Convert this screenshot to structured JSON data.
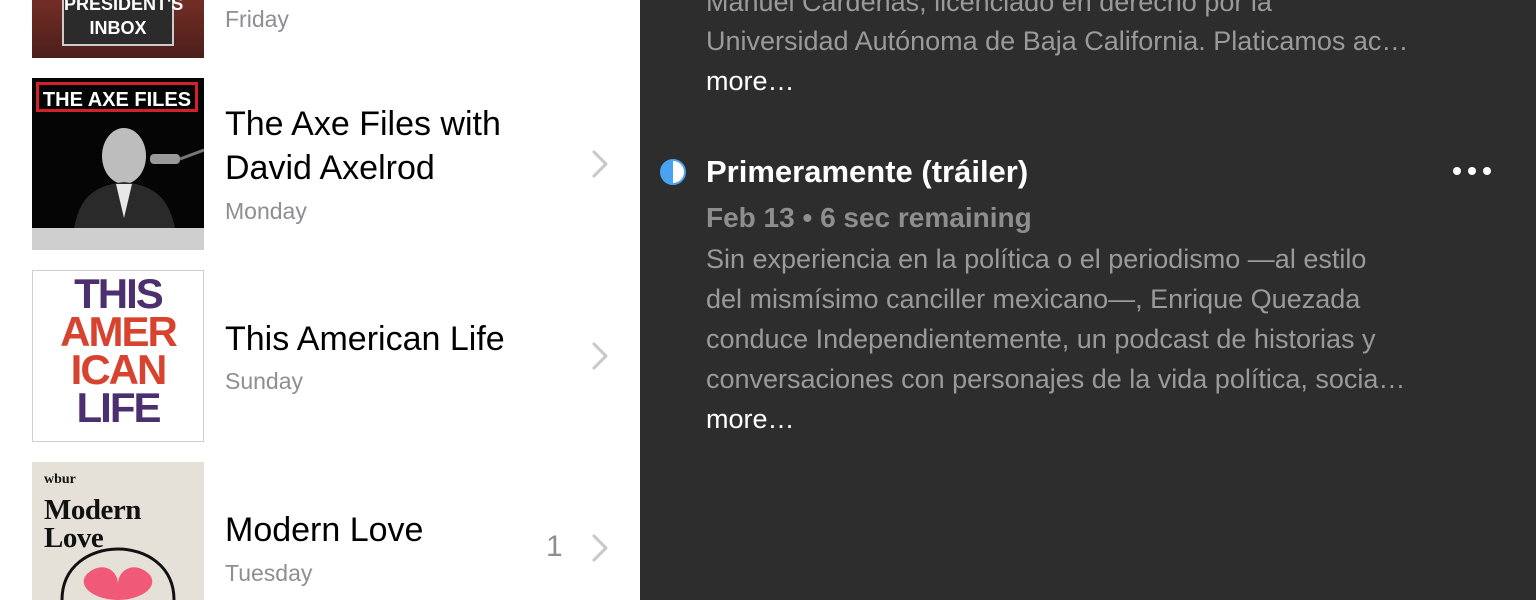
{
  "list": {
    "items": [
      {
        "art_text": "PRESIDENT'S INBOX",
        "subtitle": "Friday"
      },
      {
        "art_text": "THE AXE FILES",
        "title_line1": "The Axe Files with",
        "title_line2": "David Axelrod",
        "subtitle": "Monday"
      },
      {
        "art_lines": [
          "THIS",
          "AMER",
          "ICAN",
          "LIFE"
        ],
        "title": "This American Life",
        "subtitle": "Sunday"
      },
      {
        "art_top": "wbur",
        "art_title_line1": "Modern",
        "art_title_line2": "Love",
        "title": "Modern Love",
        "subtitle": "Tuesday",
        "count": "1"
      }
    ]
  },
  "detail": {
    "previous": {
      "line1": "Manuel Cárdenas, licenciado en derecho por la",
      "line2": "Universidad Autónoma de Baja California. Platicamos ac…",
      "more": "more…"
    },
    "episode": {
      "title": "Primeramente (tráiler)",
      "meta": "Feb 13 • 6 sec remaining",
      "lines": [
        "Sin experiencia en la política o el periodismo —al estilo",
        "del mismísimo canciller mexicano—, Enrique Quezada",
        "conduce Independientemente, un podcast de historias y",
        "conversaciones con personajes de la vida política, socia…"
      ],
      "more": "more…"
    }
  },
  "colors": {
    "panel_bg": "#2d2d2d",
    "accent_blue": "#4aa3f0",
    "secondary_text": "#8e8e93"
  },
  "icons": [
    "chevron-right-icon",
    "progress-half-icon",
    "more-options-icon"
  ]
}
